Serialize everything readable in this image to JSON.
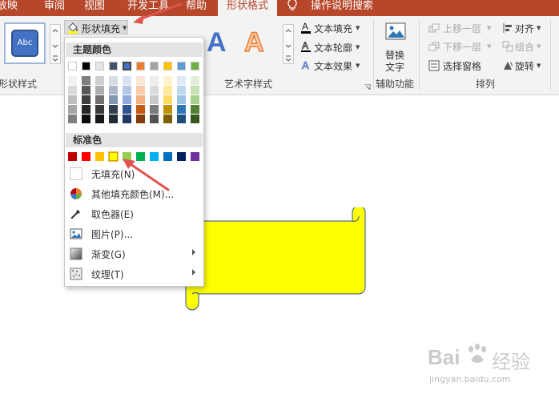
{
  "tabs": [
    "放映",
    "审阅",
    "视图",
    "开发工具",
    "帮助",
    "形状格式",
    "操作说明搜索"
  ],
  "ribbon": {
    "style_preview": "Abc",
    "shape_fill": "形状填充",
    "shape_styles_group": "形状样式",
    "text_fill": "文本填充",
    "text_outline": "文本轮廓",
    "text_effects": "文本效果",
    "wordart_letter": "A",
    "wordart_group": "艺术字样式",
    "alt_text_line1": "替换",
    "alt_text_line2": "文字",
    "accessibility_group": "辅助功能",
    "bring_forward": "上移一层",
    "send_backward": "下移一层",
    "selection_pane": "选择窗格",
    "align": "对齐",
    "group": "组合",
    "rotate": "旋转",
    "arrange_group": "排列"
  },
  "menu": {
    "theme_colors": "主题颜色",
    "standard_colors": "标准色",
    "no_fill": "无填充",
    "no_fill_key": "(N)",
    "more_colors": "其他填充颜色(M)...",
    "eyedropper": "取色器(E)",
    "picture": "图片(P)...",
    "gradient": "渐变(G)",
    "texture": "纹理(T)"
  },
  "theme_top": [
    "#ffffff",
    "#000000",
    "#e7e6e6",
    "#44546a",
    "#4472c4",
    "#ed7d31",
    "#a5a5a5",
    "#ffc000",
    "#5b9bd5",
    "#70ad47"
  ],
  "theme_shades": [
    [
      "#f2f2f2",
      "#d9d9d9",
      "#bfbfbf",
      "#a6a6a6",
      "#808080"
    ],
    [
      "#808080",
      "#595959",
      "#404040",
      "#262626",
      "#0d0d0d"
    ],
    [
      "#d0cece",
      "#aeabab",
      "#757070",
      "#3a3838",
      "#171616"
    ],
    [
      "#d6dce4",
      "#adb9ca",
      "#8497b0",
      "#333f4f",
      "#222a35"
    ],
    [
      "#dae3f3",
      "#b4c7e7",
      "#8faadc",
      "#2f5597",
      "#1f3864"
    ],
    [
      "#fbe5d6",
      "#f8cbad",
      "#f4b183",
      "#c55a11",
      "#843c0c"
    ],
    [
      "#ededed",
      "#dbdbdb",
      "#c9c9c9",
      "#7b7b7b",
      "#525252"
    ],
    [
      "#fff2cc",
      "#ffe699",
      "#ffd966",
      "#bf9000",
      "#7f6000"
    ],
    [
      "#deebf7",
      "#bdd7ee",
      "#9dc3e6",
      "#2e75b6",
      "#1f4e79"
    ],
    [
      "#e2f0d9",
      "#c5e0b4",
      "#a9d18e",
      "#548235",
      "#385723"
    ]
  ],
  "standard": [
    "#c00000",
    "#ff0000",
    "#ffc000",
    "#ffff00",
    "#92d050",
    "#00b050",
    "#00b0f0",
    "#0070c0",
    "#002060",
    "#7030a0"
  ],
  "colors": {
    "accent": "#b7472a",
    "shape_fill": "#ffff00",
    "shape_outline": "#2f528f",
    "arrow": "#e0544f"
  },
  "watermark": {
    "brand": "Bai",
    "brand_tail": "经验",
    "site": "jingyan.baidu.com"
  }
}
